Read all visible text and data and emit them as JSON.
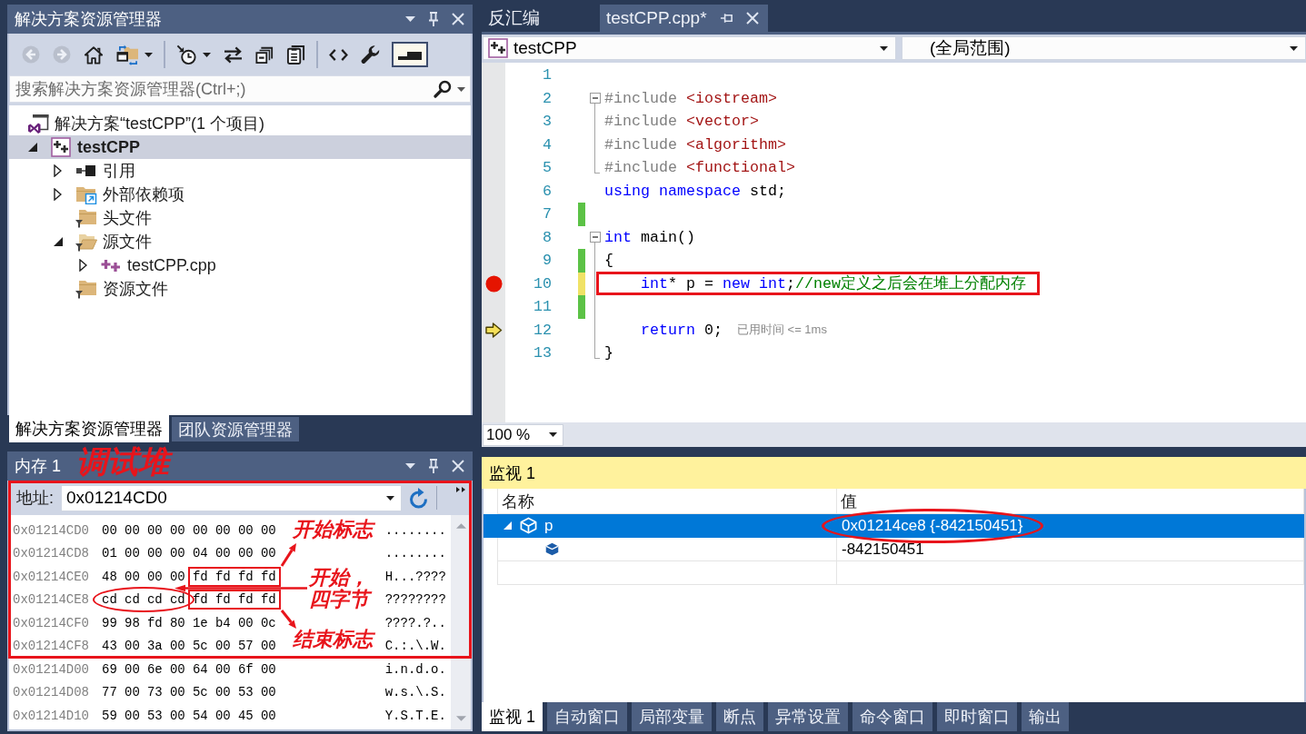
{
  "solution_explorer": {
    "title": "解决方案资源管理器",
    "toolbar": [
      [
        {
          "kind": "back",
          "disabled": true,
          "on": false,
          "menu": false
        },
        {
          "kind": "forward",
          "disabled": true,
          "on": false,
          "menu": false
        },
        {
          "kind": "home",
          "disabled": false,
          "on": false,
          "menu": false
        },
        {
          "kind": "sync",
          "disabled": false,
          "on": false,
          "menu": true
        }
      ],
      [
        {
          "kind": "pending",
          "disabled": false,
          "on": false,
          "menu": true
        },
        {
          "kind": "swap",
          "disabled": false,
          "on": false,
          "menu": false
        },
        {
          "kind": "collapse",
          "disabled": false,
          "on": false,
          "menu": false
        },
        {
          "kind": "pages",
          "disabled": false,
          "on": false,
          "menu": false
        }
      ],
      [
        {
          "kind": "code",
          "disabled": false,
          "on": false,
          "menu": false
        },
        {
          "kind": "wrench",
          "disabled": false,
          "on": false,
          "menu": false
        },
        {
          "kind": "preview",
          "disabled": false,
          "on": true,
          "menu": false
        }
      ]
    ],
    "search": {
      "placeholder": "搜索解决方案资源管理器(Ctrl+;)"
    },
    "tree": [
      {
        "label": "解决方案“testCPP”(1 个项目)",
        "kind": "solution",
        "selected": false,
        "startup": false,
        "children": [
          {
            "label": "testCPP",
            "kind": "project",
            "selected": true,
            "startup": true,
            "expanded": true,
            "children": [
              {
                "label": "引用",
                "kind": "references",
                "selected": false,
                "startup": false,
                "expanded": false
              },
              {
                "label": "外部依赖项",
                "kind": "external",
                "selected": false,
                "startup": false,
                "expanded": false
              },
              {
                "label": "头文件",
                "kind": "filter",
                "selected": false,
                "startup": false
              },
              {
                "label": "源文件",
                "kind": "filter",
                "selected": false,
                "startup": false,
                "expanded": true,
                "children": [
                  {
                    "label": "testCPP.cpp",
                    "kind": "cpp",
                    "selected": false,
                    "startup": false,
                    "expanded": false
                  }
                ]
              },
              {
                "label": "资源文件",
                "kind": "filter",
                "selected": false,
                "startup": false
              }
            ]
          }
        ]
      }
    ],
    "tabs": [
      {
        "label": "解决方案资源管理器",
        "selected": true
      },
      {
        "label": "团队资源管理器",
        "selected": false
      }
    ]
  },
  "editor": {
    "tabs": [
      {
        "label": "反汇编",
        "selected": false
      },
      {
        "label": "testCPP.cpp*",
        "selected": true
      }
    ],
    "navigation": {
      "project": "testCPP",
      "scope": "(全局范围)"
    },
    "lines": [
      {
        "number": "1",
        "boxed": false
      },
      {
        "number": "2",
        "outline": {
          "kind": "collapse"
        },
        "boxed": false,
        "tokens": [
          {
            "kind": "directive",
            "text": "#include "
          },
          {
            "kind": "string",
            "text": "<iostream>"
          }
        ]
      },
      {
        "number": "3",
        "outline": {
          "kind": "line"
        },
        "boxed": false,
        "tokens": [
          {
            "kind": "directive",
            "text": "#include "
          },
          {
            "kind": "string",
            "text": "<vector>"
          }
        ]
      },
      {
        "number": "4",
        "outline": {
          "kind": "line"
        },
        "boxed": false,
        "tokens": [
          {
            "kind": "directive",
            "text": "#include "
          },
          {
            "kind": "string",
            "text": "<algorithm>"
          }
        ]
      },
      {
        "number": "5",
        "outline": {
          "kind": "end"
        },
        "boxed": false,
        "tokens": [
          {
            "kind": "directive",
            "text": "#include "
          },
          {
            "kind": "string",
            "text": "<functional>"
          }
        ]
      },
      {
        "number": "6",
        "boxed": false,
        "tokens": [
          {
            "kind": "keyword",
            "text": "using namespace"
          },
          {
            "kind": "plain",
            "text": " std;"
          }
        ]
      },
      {
        "number": "7",
        "change": {
          "kind": "saved"
        },
        "boxed": false
      },
      {
        "number": "8",
        "outline": {
          "kind": "collapse"
        },
        "boxed": false,
        "tokens": [
          {
            "kind": "keyword",
            "text": "int"
          },
          {
            "kind": "plain",
            "text": " main()"
          }
        ]
      },
      {
        "number": "9",
        "change": {
          "kind": "saved"
        },
        "outline": {
          "kind": "line"
        },
        "boxed": false,
        "tokens": [
          {
            "kind": "plain",
            "text": "{"
          }
        ],
        "children": [
          {
            "number": "10",
            "change": {
              "kind": "unsaved"
            },
            "glyph": {
              "kind": "breakpoint"
            },
            "outline": {
              "kind": "line"
            },
            "boxed": true,
            "tokens": [
              {
                "kind": "keyword",
                "text": "int"
              },
              {
                "kind": "plain",
                "text": "* p = "
              },
              {
                "kind": "keyword",
                "text": "new int"
              },
              {
                "kind": "plain",
                "text": ";"
              },
              {
                "kind": "comment",
                "text": "//new定义之后会在堆上分配内存"
              }
            ]
          },
          {
            "number": "11",
            "change": {
              "kind": "saved"
            },
            "outline": {
              "kind": "line"
            },
            "boxed": false
          },
          {
            "number": "12",
            "glyph": {
              "kind": "current"
            },
            "outline": {
              "kind": "line"
            },
            "boxed": false,
            "tokens": [
              {
                "kind": "keyword",
                "text": "return"
              },
              {
                "kind": "plain",
                "text": " 0;"
              }
            ],
            "tip": "已用时间 <= 1ms"
          }
        ]
      },
      {
        "number": "13",
        "outline": {
          "kind": "end"
        },
        "boxed": false,
        "tokens": [
          {
            "kind": "plain",
            "text": "}"
          }
        ]
      }
    ],
    "zoom": "100 %"
  },
  "memory": {
    "title": "内存 1",
    "note": "调试堆",
    "frame": true,
    "address_label": "地址:",
    "address_field": {
      "value": "0x01214CD0"
    },
    "rows": [
      {
        "address": "0x01214CD0",
        "groups": [
          {
            "kind": "plain",
            "bytes": [
              "00",
              "00",
              "00",
              "00"
            ]
          },
          {
            "kind": "plain",
            "bytes": [
              "00",
              "00",
              "00",
              "00"
            ]
          }
        ],
        "ascii": "........"
      },
      {
        "address": "0x01214CD8",
        "groups": [
          {
            "kind": "plain",
            "bytes": [
              "01",
              "00",
              "00",
              "00"
            ]
          },
          {
            "kind": "plain",
            "bytes": [
              "04",
              "00",
              "00",
              "00"
            ]
          }
        ],
        "ascii": "........"
      },
      {
        "address": "0x01214CE0",
        "groups": [
          {
            "kind": "plain",
            "bytes": [
              "48",
              "00",
              "00",
              "00"
            ]
          },
          {
            "kind": "boxed",
            "bytes": [
              "fd",
              "fd",
              "fd",
              "fd"
            ]
          }
        ],
        "ascii": "H...????"
      },
      {
        "address": "0x01214CE8",
        "groups": [
          {
            "kind": "circled",
            "bytes": [
              "cd",
              "cd",
              "cd",
              "cd"
            ]
          },
          {
            "kind": "boxed",
            "bytes": [
              "fd",
              "fd",
              "fd",
              "fd"
            ]
          }
        ],
        "ascii": "????????"
      },
      {
        "address": "0x01214CF0",
        "groups": [
          {
            "kind": "plain",
            "bytes": [
              "99",
              "98",
              "fd",
              "80"
            ]
          },
          {
            "kind": "plain",
            "bytes": [
              "1e",
              "b4",
              "00",
              "0c"
            ]
          }
        ],
        "ascii": "????.?.."
      },
      {
        "address": "0x01214CF8",
        "groups": [
          {
            "kind": "plain",
            "bytes": [
              "43",
              "00",
              "3a",
              "00"
            ]
          },
          {
            "kind": "plain",
            "bytes": [
              "5c",
              "00",
              "57",
              "00"
            ]
          }
        ],
        "ascii": "C.:.\\.W."
      },
      {
        "address": "0x01214D00",
        "groups": [
          {
            "kind": "plain",
            "bytes": [
              "69",
              "00",
              "6e",
              "00"
            ]
          },
          {
            "kind": "plain",
            "bytes": [
              "64",
              "00",
              "6f",
              "00"
            ]
          }
        ],
        "ascii": "i.n.d.o."
      },
      {
        "address": "0x01214D08",
        "groups": [
          {
            "kind": "plain",
            "bytes": [
              "77",
              "00",
              "73",
              "00"
            ]
          },
          {
            "kind": "plain",
            "bytes": [
              "5c",
              "00",
              "53",
              "00"
            ]
          }
        ],
        "ascii": "w.s.\\.S."
      },
      {
        "address": "0x01214D10",
        "groups": [
          {
            "kind": "plain",
            "bytes": [
              "59",
              "00",
              "53",
              "00"
            ]
          },
          {
            "kind": "plain",
            "bytes": [
              "54",
              "00",
              "45",
              "00"
            ]
          }
        ],
        "ascii": "Y.S.T.E."
      }
    ],
    "callouts": [
      {
        "text": "开始标志"
      },
      {
        "text": "开始，四字节"
      },
      {
        "text": "结束标志"
      }
    ]
  },
  "watch": {
    "title": "监视 1",
    "focused": true,
    "columns": [
      "名称",
      "值"
    ],
    "rows": [
      {
        "name": "p",
        "value": "0x01214ce8 {-842150451}",
        "selected": true,
        "expanded": true,
        "circled": true,
        "children": [
          {
            "value": "-842150451",
            "selected": false,
            "circled": false
          }
        ]
      }
    ],
    "tabs": [
      {
        "label": "监视 1",
        "selected": true
      },
      {
        "label": "自动窗口",
        "selected": false
      },
      {
        "label": "局部变量",
        "selected": false
      },
      {
        "label": "断点",
        "selected": false
      },
      {
        "label": "异常设置",
        "selected": false
      },
      {
        "label": "命令窗口",
        "selected": false
      },
      {
        "label": "即时窗口",
        "selected": false
      },
      {
        "label": "输出",
        "selected": false
      }
    ]
  }
}
